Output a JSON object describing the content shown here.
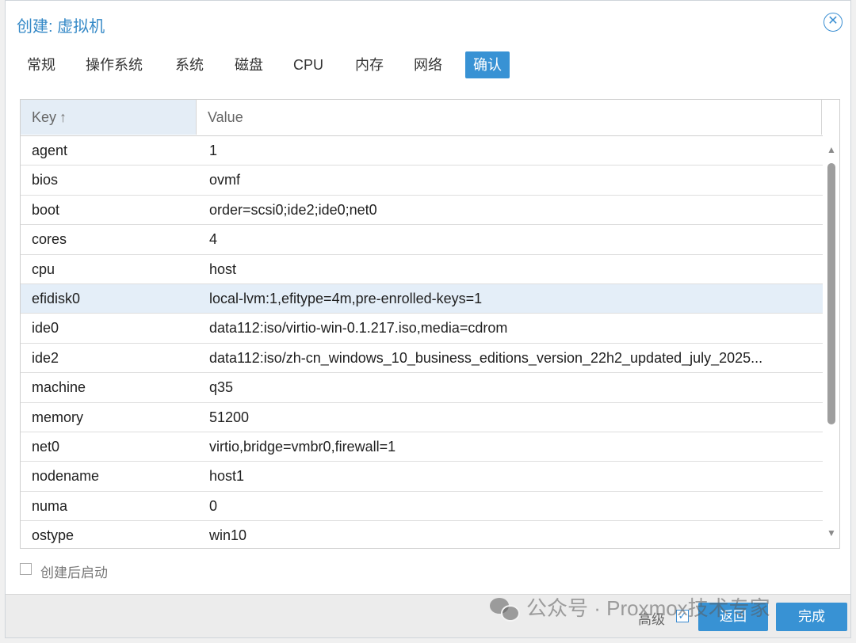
{
  "dialog": {
    "title": "创建: 虚拟机",
    "close_glyph": "✕"
  },
  "tabs": [
    {
      "label": "常规",
      "active": false
    },
    {
      "label": "操作系统",
      "active": false
    },
    {
      "label": "系统",
      "active": false
    },
    {
      "label": "磁盘",
      "active": false
    },
    {
      "label": "CPU",
      "active": false
    },
    {
      "label": "内存",
      "active": false
    },
    {
      "label": "网络",
      "active": false
    },
    {
      "label": "确认",
      "active": true
    }
  ],
  "grid": {
    "columns": {
      "key": "Key",
      "value": "Value"
    },
    "sort_indicator": "↑",
    "selected_row": "efidisk0",
    "rows": [
      {
        "key": "agent",
        "value": "1"
      },
      {
        "key": "bios",
        "value": "ovmf"
      },
      {
        "key": "boot",
        "value": "order=scsi0;ide2;ide0;net0"
      },
      {
        "key": "cores",
        "value": "4"
      },
      {
        "key": "cpu",
        "value": "host"
      },
      {
        "key": "efidisk0",
        "value": "local-lvm:1,efitype=4m,pre-enrolled-keys=1"
      },
      {
        "key": "ide0",
        "value": "data112:iso/virtio-win-0.1.217.iso,media=cdrom"
      },
      {
        "key": "ide2",
        "value": "data112:iso/zh-cn_windows_10_business_editions_version_22h2_updated_july_2025..."
      },
      {
        "key": "machine",
        "value": "q35"
      },
      {
        "key": "memory",
        "value": "51200"
      },
      {
        "key": "net0",
        "value": "virtio,bridge=vmbr0,firewall=1"
      },
      {
        "key": "nodename",
        "value": "host1"
      },
      {
        "key": "numa",
        "value": "0"
      },
      {
        "key": "ostype",
        "value": "win10"
      }
    ]
  },
  "scroll": {
    "up_glyph": "▲",
    "down_glyph": "▼"
  },
  "start_after_create": {
    "label": "创建后启动",
    "checked": false
  },
  "footer": {
    "advanced_label": "高级",
    "advanced_checked": true,
    "advanced_glyph": "✓",
    "back_label": "返回",
    "finish_label": "完成"
  },
  "watermark": {
    "text": "公众号 · Proxmox技术专家"
  },
  "colors": {
    "accent": "#3892d4",
    "selected_row": "#e4eef8",
    "title": "#3589c7"
  }
}
